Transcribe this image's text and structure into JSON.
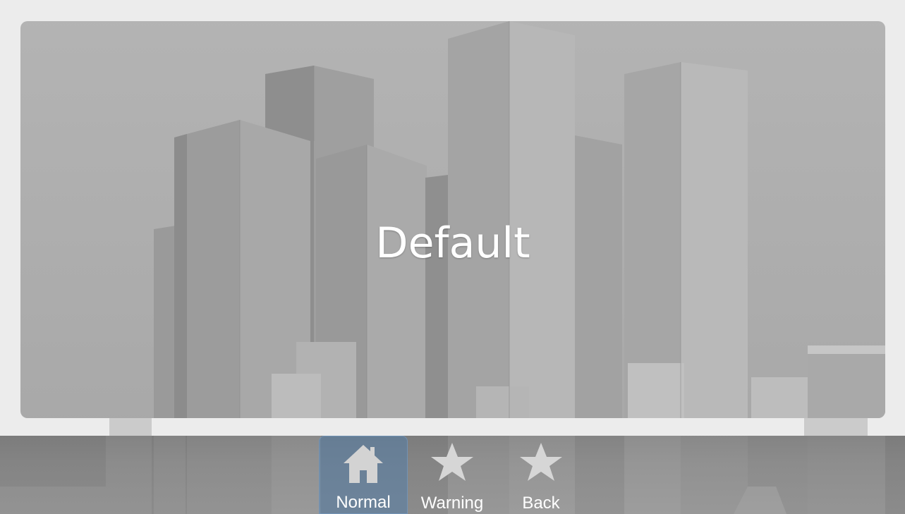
{
  "panel": {
    "title": "Default"
  },
  "nav": {
    "items": [
      {
        "label": "Normal",
        "icon": "home-icon",
        "active": true
      },
      {
        "label": "Warning",
        "icon": "star-icon",
        "active": false
      },
      {
        "label": "Back",
        "icon": "star-icon",
        "active": false
      }
    ]
  },
  "colors": {
    "background": "#ececec",
    "active_tab": "#5a83ac",
    "text": "#ffffff"
  }
}
